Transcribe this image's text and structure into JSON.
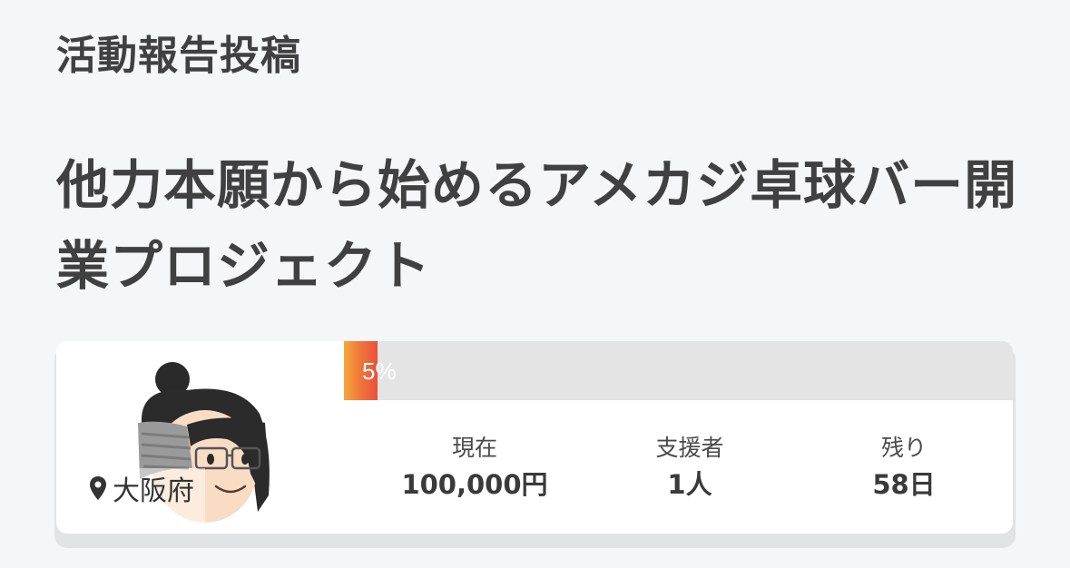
{
  "section_label": "活動報告投稿",
  "project": {
    "title": "他力本願から始めるアメカジ卓球バー開業プロジェクト"
  },
  "card": {
    "progress": {
      "percent": 5,
      "label": "5%",
      "fill_colors": [
        "#f3a83a",
        "#ea4f3d"
      ]
    },
    "location": {
      "icon": "map-pin-icon",
      "text": "大阪府"
    },
    "stats": {
      "current": {
        "label": "現在",
        "value": "100,000円"
      },
      "supporters": {
        "label": "支援者",
        "value": "1人"
      },
      "remaining": {
        "label": "残り",
        "value": "58日"
      }
    }
  }
}
